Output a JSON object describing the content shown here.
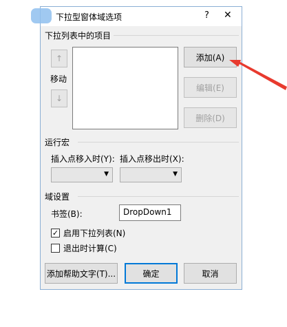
{
  "dialog": {
    "title": "下拉型窗体域选项",
    "help_icon": "?",
    "close_icon": "✕"
  },
  "list_section": {
    "label": "下拉列表中的项目",
    "up_arrow": "↑",
    "down_arrow": "↓",
    "move_label": "移动",
    "add_button": "添加(A)",
    "edit_button": "编辑(E)",
    "delete_button": "删除(D)"
  },
  "macro_section": {
    "label": "运行宏",
    "entry_label": "插入点移入时(Y):",
    "exit_label": "插入点移出时(X):"
  },
  "field_settings": {
    "label": "域设置",
    "bookmark_label": "书签(B):",
    "bookmark_value": "DropDown1",
    "enable_dropdown_label": "启用下拉列表(N)",
    "enable_dropdown_checked": true,
    "calc_on_exit_label": "退出时计算(C)",
    "calc_on_exit_checked": false
  },
  "footer": {
    "add_help_text_button": "添加帮助文字(T)...",
    "ok_button": "确定",
    "cancel_button": "取消"
  },
  "colors": {
    "annotation_arrow": "#e83a2e",
    "default_button_border": "#0078d7"
  }
}
